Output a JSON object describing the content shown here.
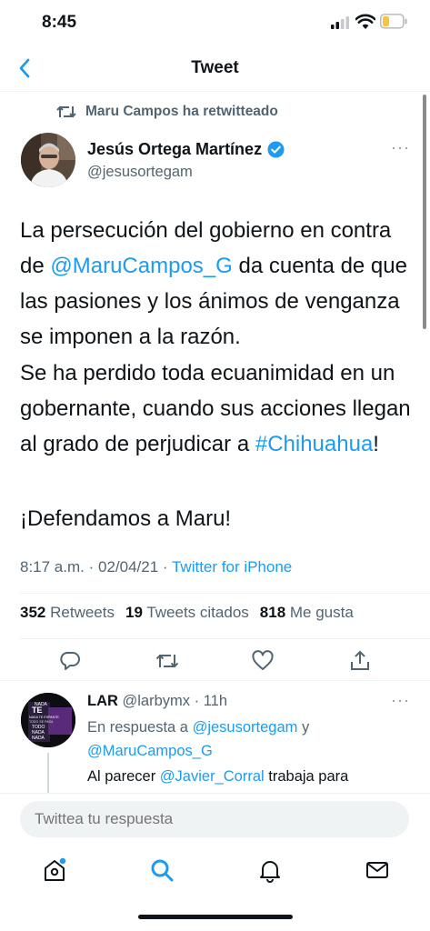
{
  "status_bar": {
    "time": "8:45"
  },
  "header": {
    "title": "Tweet"
  },
  "retweet_context": {
    "text": "Maru Campos ha retwitteado"
  },
  "tweet": {
    "author_name": "Jesús Ortega Martínez",
    "author_handle": "@jesusortegam",
    "more": "···",
    "p1_before": "La persecución del gobierno en contra de ",
    "p1_mention": "@MaruCampos_G",
    "p1_after": " da cuenta de que las pasiones y los ánimos de venganza se imponen a la razón.",
    "p2_before": "Se ha perdido toda ecuanimidad en un gobernante, cuando sus acciones llegan al grado de perjudicar a ",
    "p2_hashtag": "#Chihuahua",
    "p2_after": "!",
    "p3": "¡Defendamos a Maru!",
    "time": "8:17 a.m.",
    "date": "02/04/21",
    "source": "Twitter for iPhone",
    "retweets_count": "352",
    "retweets_label": "Retweets",
    "quotes_count": "19",
    "quotes_label": "Tweets citados",
    "likes_count": "818",
    "likes_label": "Me gusta"
  },
  "reply": {
    "author_name": "LAR",
    "author_handle": "@larbymx",
    "age": "11h",
    "more": "···",
    "in_reply_prefix": "En respuesta a",
    "in_reply_user1": "@jesusortegam",
    "in_reply_join": "y",
    "in_reply_user2": "@MaruCampos_G",
    "text_before": "Al parecer ",
    "text_mention": "@Javier_Corral",
    "text_after": " trabaja para",
    "avatar_words": [
      "NADA",
      "TE",
      "NADA TE ESPANTE",
      "TODO SE PASA",
      "TODO",
      "NADA",
      "NADA"
    ]
  },
  "compose": {
    "placeholder": "Twittea tu respuesta"
  },
  "icons": {
    "back": "chevron-left-icon",
    "retweet": "retweet-icon",
    "verified": "verified-badge-icon",
    "reply": "reply-icon",
    "like": "heart-icon",
    "share": "share-icon",
    "home": "home-icon",
    "search": "search-icon",
    "notifications": "bell-icon",
    "messages": "mail-icon"
  },
  "colors": {
    "accent": "#1d9bf0",
    "text": "#0f1419",
    "secondary": "#536471",
    "battery": "#f5c542"
  }
}
